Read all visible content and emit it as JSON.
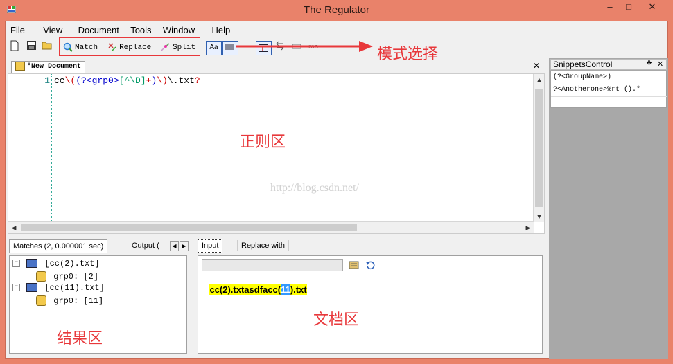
{
  "window": {
    "title": "The Regulator",
    "controls": [
      "–",
      "□",
      "✕"
    ]
  },
  "menu": [
    "File",
    "View",
    "Document",
    "Tools",
    "Window",
    "Help"
  ],
  "toolbar": {
    "match_label": "Match",
    "replace_label": "Replace",
    "split_label": "Split",
    "case_label": "Aa"
  },
  "document": {
    "tab_label": "*New Document",
    "close": "✕",
    "line_number": "1",
    "regex_tokens": [
      {
        "text": "cc",
        "color": "#000000"
      },
      {
        "text": "\\(",
        "color": "#cc0000"
      },
      {
        "text": "(?<",
        "color": "#0000cc"
      },
      {
        "text": "grp0",
        "color": "#0000cc"
      },
      {
        "text": ">",
        "color": "#0000cc"
      },
      {
        "text": "[^\\D]",
        "color": "#009966"
      },
      {
        "text": "+",
        "color": "#cc0000"
      },
      {
        "text": ")",
        "color": "#0000cc"
      },
      {
        "text": "\\)",
        "color": "#cc0000"
      },
      {
        "text": "\\.txt",
        "color": "#000000"
      },
      {
        "text": "?",
        "color": "#cc0000"
      }
    ]
  },
  "watermark": "http://blog.csdn.net/",
  "annotations": {
    "mode": "模式选择",
    "regex_area": "正则区",
    "results_area": "结果区",
    "document_area": "文档区"
  },
  "results": {
    "tab_matches": "Matches (2, 0.000001 sec)",
    "tab_output": "Output (",
    "tree": [
      {
        "label": "[cc(2).txt]",
        "child": "grp0: [2]"
      },
      {
        "label": "[cc(11).txt]",
        "child": "grp0: [11]"
      }
    ]
  },
  "input_panel": {
    "tab_input": "Input",
    "tab_replace": "Replace with",
    "replace_value": "",
    "text_before": "cc(2).txtasdfacc(",
    "text_selected": "11",
    "text_after": ").txt"
  },
  "snippets": {
    "title": "SnippetsControl",
    "pin": "❖",
    "close": "✕",
    "items": [
      "(?<GroupName>)",
      "?<Anotherone>%rt ().*"
    ]
  },
  "colors": {
    "frame": "#e9826a",
    "highlight_yellow": "#ffff00",
    "selection_blue": "#3399ff",
    "annotation_red": "#e8383b"
  }
}
